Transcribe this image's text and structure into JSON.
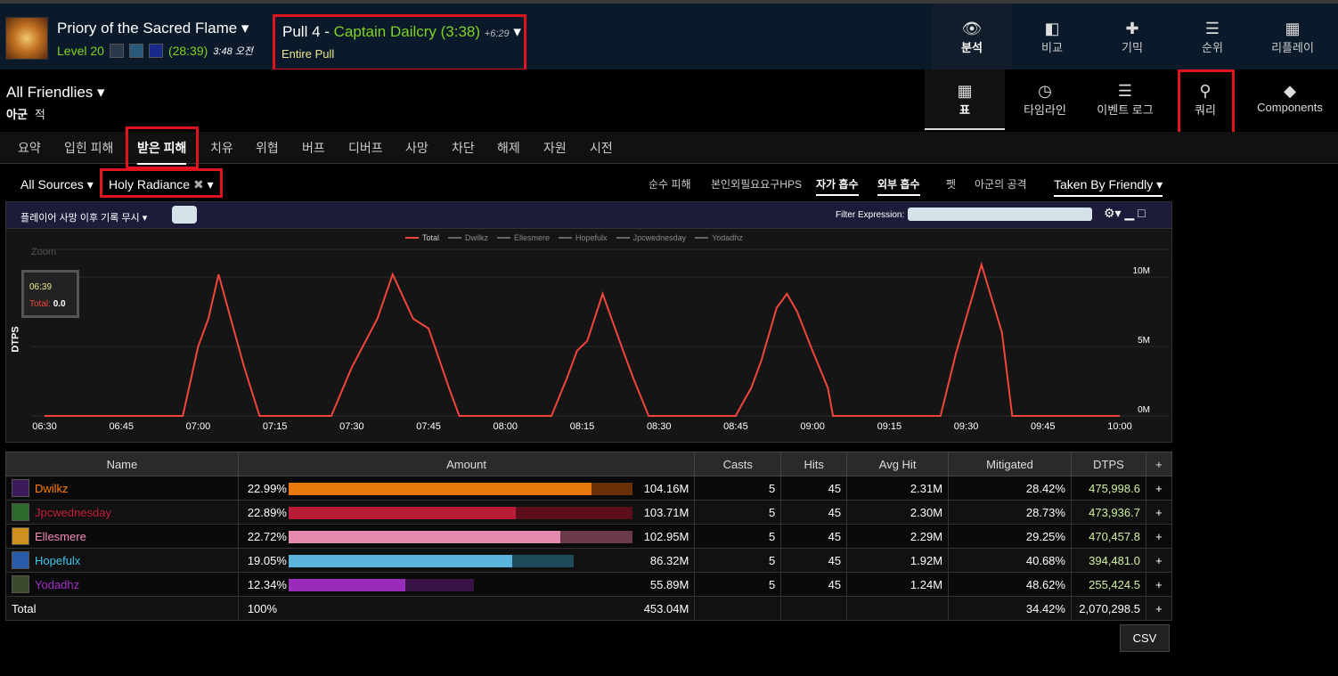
{
  "header": {
    "zone": "Priory of the Sacred Flame",
    "level": "Level 20",
    "duration": "(28:39)",
    "datetime": "3:48 오전",
    "pull_label": "Pull 4 - ",
    "boss": "Captain Dailcry (3:38)",
    "delta": "+6:29",
    "pull_sub": "Entire Pull",
    "nav": [
      "분석",
      "비교",
      "기믹",
      "순위",
      "리플레이"
    ]
  },
  "friendly": {
    "title": "All Friendlies",
    "ally": "아군",
    "enemy": "적"
  },
  "views": [
    "표",
    "타임라인",
    "이벤트 로그",
    "쿼리",
    "Components"
  ],
  "tabs": [
    "요약",
    "입힌 피해",
    "받은 피해",
    "치유",
    "위협",
    "버프",
    "디버프",
    "사망",
    "차단",
    "해제",
    "자원",
    "시전"
  ],
  "filters": {
    "sources": "All Sources",
    "ability": "Holy Radiance",
    "modes": [
      "순수 피해",
      "본인외필요요구HPS",
      "자가 흡수",
      "외부 흡수",
      "펫",
      "아군의 공격"
    ],
    "taken_by": "Taken By Friendly"
  },
  "chart_head": {
    "ignore_death": "플레이어 사망 이후 기록 무시",
    "filter_label": "Filter Expression:"
  },
  "chart_data": {
    "type": "line",
    "ylabel": "DTPS",
    "x_ticks": [
      "06:30",
      "06:45",
      "07:00",
      "07:15",
      "07:30",
      "07:45",
      "08:00",
      "08:15",
      "08:30",
      "08:45",
      "09:00",
      "09:15",
      "09:30",
      "09:45",
      "10:00"
    ],
    "y_ticks": [
      "10M",
      "5M",
      "0M"
    ],
    "ylim": [
      0,
      12000000
    ],
    "series": [
      {
        "name": "Total",
        "color": "#f0463c"
      },
      {
        "name": "Dwilkz"
      },
      {
        "name": "Ellesmere"
      },
      {
        "name": "Hopefulx"
      },
      {
        "name": "Jpcwednesday"
      },
      {
        "name": "Yodadhz"
      }
    ],
    "total_points": [
      [
        "06:30",
        0
      ],
      [
        "06:45",
        0
      ],
      [
        "06:57",
        0
      ],
      [
        "07:00",
        5000000
      ],
      [
        "07:02",
        7000000
      ],
      [
        "07:04",
        10200000
      ],
      [
        "07:06",
        7500000
      ],
      [
        "07:09",
        3500000
      ],
      [
        "07:12",
        0
      ],
      [
        "07:15",
        0
      ],
      [
        "07:26",
        0
      ],
      [
        "07:30",
        3500000
      ],
      [
        "07:35",
        7000000
      ],
      [
        "07:38",
        10200000
      ],
      [
        "07:42",
        7000000
      ],
      [
        "07:45",
        6300000
      ],
      [
        "07:49",
        2000000
      ],
      [
        "07:51",
        0
      ],
      [
        "08:00",
        0
      ],
      [
        "08:09",
        0
      ],
      [
        "08:12",
        2700000
      ],
      [
        "08:14",
        4700000
      ],
      [
        "08:16",
        5400000
      ],
      [
        "08:19",
        8800000
      ],
      [
        "08:23",
        4700000
      ],
      [
        "08:25",
        2700000
      ],
      [
        "08:28",
        0
      ],
      [
        "08:45",
        0
      ],
      [
        "08:46",
        700000
      ],
      [
        "08:48",
        2000000
      ],
      [
        "08:50",
        4000000
      ],
      [
        "08:53",
        7800000
      ],
      [
        "08:55",
        8800000
      ],
      [
        "08:57",
        7500000
      ],
      [
        "09:00",
        4700000
      ],
      [
        "09:03",
        2000000
      ],
      [
        "09:04",
        0
      ],
      [
        "09:15",
        0
      ],
      [
        "09:25",
        0
      ],
      [
        "09:28",
        4500000
      ],
      [
        "09:33",
        10900000
      ],
      [
        "09:37",
        6000000
      ],
      [
        "09:39",
        0
      ],
      [
        "10:00",
        0
      ]
    ],
    "zoom_label": "Zoom",
    "tooltip": {
      "time": "06:39",
      "label": "Total:",
      "value": "0.0"
    }
  },
  "table": {
    "headers": [
      "Name",
      "Amount",
      "Casts",
      "Hits",
      "Avg Hit",
      "Mitigated",
      "DTPS",
      "+"
    ],
    "rows": [
      {
        "name": "Dwilkz",
        "color": "#ff7c0a",
        "pct": "22.99%",
        "fill": 0.88,
        "rest": 0.12,
        "bar": "#e8780c",
        "bar2": "#6a3008",
        "amount": "104.16M",
        "casts": "5",
        "hits": "45",
        "avg": "2.31M",
        "mit": "28.42%",
        "dtps": "475,998.6",
        "icon": "#3a1a5a"
      },
      {
        "name": "Jpcwednesday",
        "color": "#c41e3a",
        "pct": "22.89%",
        "fill": 0.66,
        "rest": 0.34,
        "bar": "#b81c36",
        "bar2": "#5a0e1a",
        "amount": "103.71M",
        "casts": "5",
        "hits": "45",
        "avg": "2.30M",
        "mit": "28.73%",
        "dtps": "473,936.7",
        "icon": "#2a6a2a"
      },
      {
        "name": "Ellesmere",
        "color": "#f48cba",
        "pct": "22.72%",
        "fill": 0.79,
        "rest": 0.21,
        "bar": "#e48aae",
        "bar2": "#6a3a4a",
        "amount": "102.95M",
        "casts": "5",
        "hits": "45",
        "avg": "2.29M",
        "mit": "29.25%",
        "dtps": "470,457.8",
        "icon": "#d09020"
      },
      {
        "name": "Hopefulx",
        "color": "#3fc7eb",
        "pct": "19.05%",
        "fill": 0.65,
        "rest": 0.18,
        "bar": "#5ab4dc",
        "bar2": "#1e4a5a",
        "amount": "86.32M",
        "casts": "5",
        "hits": "45",
        "avg": "1.92M",
        "mit": "40.68%",
        "dtps": "394,481.0",
        "icon": "#2a5aaa"
      },
      {
        "name": "Yodadhz",
        "color": "#a330c9",
        "pct": "12.34%",
        "fill": 0.34,
        "rest": 0.2,
        "bar": "#9a2cbc",
        "bar2": "#3a1448",
        "amount": "55.89M",
        "casts": "5",
        "hits": "45",
        "avg": "1.24M",
        "mit": "48.62%",
        "dtps": "255,424.5",
        "icon": "#3a4a2a"
      }
    ],
    "total": {
      "label": "Total",
      "pct": "100%",
      "amount": "453.04M",
      "mit": "34.42%",
      "dtps": "2,070,298.5"
    },
    "csv": "CSV"
  }
}
